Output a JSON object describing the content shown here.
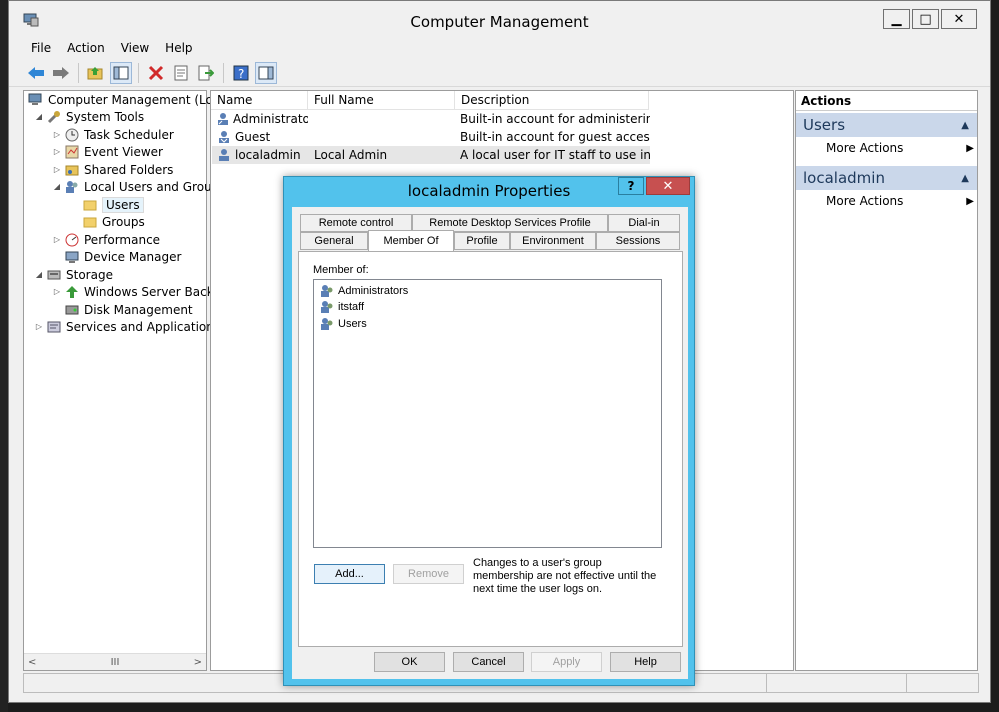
{
  "window": {
    "title": "Computer Management",
    "minimize": "▁",
    "maximize": "□",
    "close": "✕"
  },
  "menu": [
    "File",
    "Action",
    "View",
    "Help"
  ],
  "toolbar": [
    "back-icon",
    "forward-icon",
    "up-folder-icon",
    "show-hide-tree-icon",
    "delete-icon",
    "properties-icon",
    "export-icon",
    "help-icon",
    "show-hide-action-pane-icon"
  ],
  "tree": {
    "root": "Computer Management (Local",
    "system_tools": "System Tools",
    "task_scheduler": "Task Scheduler",
    "event_viewer": "Event Viewer",
    "shared_folders": "Shared Folders",
    "local_users": "Local Users and Groups",
    "users": "Users",
    "groups": "Groups",
    "performance": "Performance",
    "device_manager": "Device Manager",
    "storage": "Storage",
    "wsb": "Windows Server Backup",
    "disk_mgmt": "Disk Management",
    "services": "Services and Applications",
    "scroll_thumb": "III"
  },
  "list": {
    "headers": [
      "Name",
      "Full Name",
      "Description"
    ],
    "rows": [
      {
        "name": "Administrator",
        "full": "",
        "desc": "Built-in account for administering..."
      },
      {
        "name": "Guest",
        "full": "",
        "desc": "Built-in account for guest access t..."
      },
      {
        "name": "localadmin",
        "full": "Local Admin",
        "desc": "A local user for IT staff to use inst..."
      }
    ]
  },
  "actions": {
    "header": "Actions",
    "sec1": "Users",
    "sec1_item": "More Actions",
    "sec2": "localadmin",
    "sec2_item": "More Actions"
  },
  "dialog": {
    "title": "localadmin Properties",
    "help": "?",
    "close": "✕",
    "tabs_row1": [
      "Remote control",
      "Remote Desktop Services Profile",
      "Dial-in"
    ],
    "tabs_row2": [
      "General",
      "Member Of",
      "Profile",
      "Environment",
      "Sessions"
    ],
    "active_tab": "Member Of",
    "member_of_label": "Member of:",
    "groups": [
      "Administrators",
      "itstaff",
      "Users"
    ],
    "add": "Add...",
    "remove": "Remove",
    "note": "Changes to a user's group membership are not effective until the next time the user logs on.",
    "ok": "OK",
    "cancel": "Cancel",
    "apply": "Apply",
    "help_btn": "Help"
  }
}
